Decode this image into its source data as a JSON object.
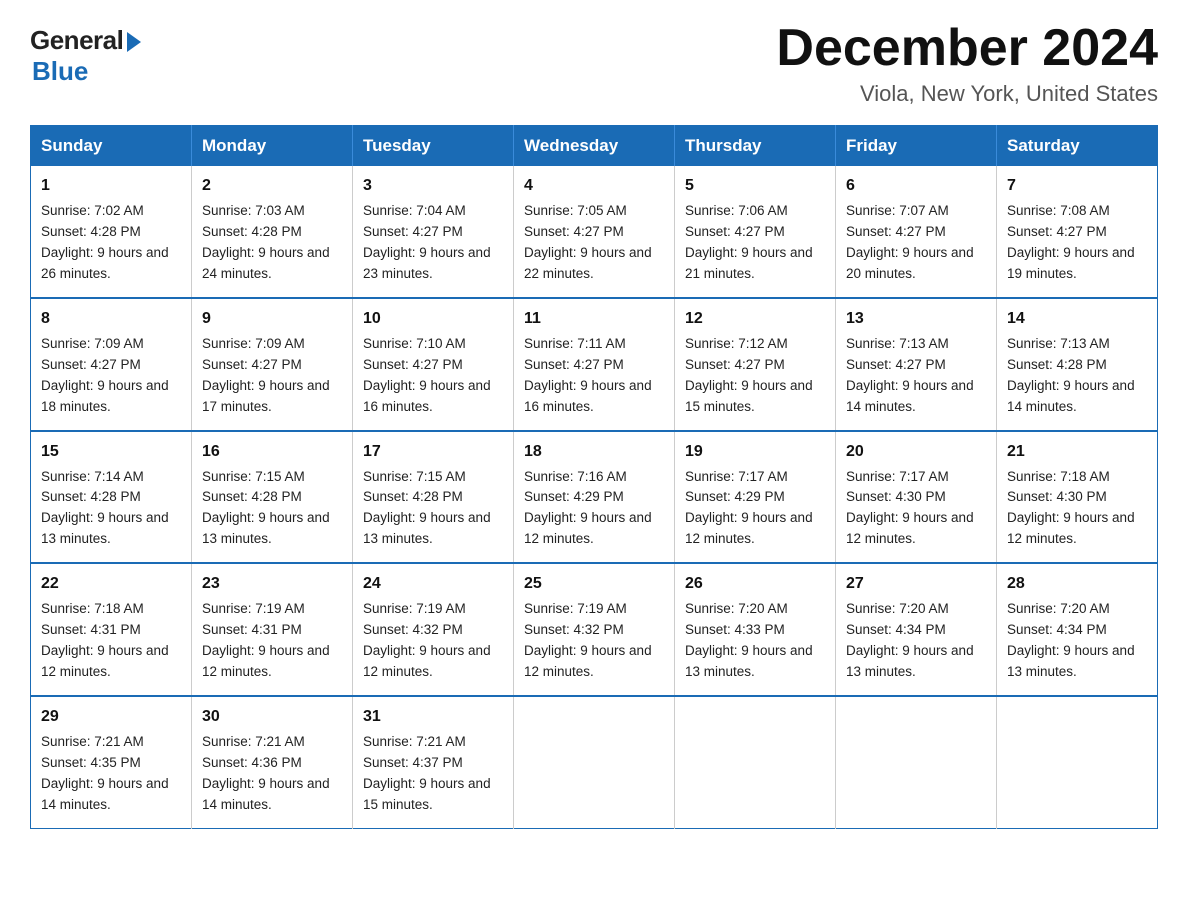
{
  "header": {
    "logo_general": "General",
    "logo_blue": "Blue",
    "month_title": "December 2024",
    "location": "Viola, New York, United States"
  },
  "days_of_week": [
    "Sunday",
    "Monday",
    "Tuesday",
    "Wednesday",
    "Thursday",
    "Friday",
    "Saturday"
  ],
  "weeks": [
    [
      {
        "day": "1",
        "sunrise": "7:02 AM",
        "sunset": "4:28 PM",
        "daylight": "9 hours and 26 minutes."
      },
      {
        "day": "2",
        "sunrise": "7:03 AM",
        "sunset": "4:28 PM",
        "daylight": "9 hours and 24 minutes."
      },
      {
        "day": "3",
        "sunrise": "7:04 AM",
        "sunset": "4:27 PM",
        "daylight": "9 hours and 23 minutes."
      },
      {
        "day": "4",
        "sunrise": "7:05 AM",
        "sunset": "4:27 PM",
        "daylight": "9 hours and 22 minutes."
      },
      {
        "day": "5",
        "sunrise": "7:06 AM",
        "sunset": "4:27 PM",
        "daylight": "9 hours and 21 minutes."
      },
      {
        "day": "6",
        "sunrise": "7:07 AM",
        "sunset": "4:27 PM",
        "daylight": "9 hours and 20 minutes."
      },
      {
        "day": "7",
        "sunrise": "7:08 AM",
        "sunset": "4:27 PM",
        "daylight": "9 hours and 19 minutes."
      }
    ],
    [
      {
        "day": "8",
        "sunrise": "7:09 AM",
        "sunset": "4:27 PM",
        "daylight": "9 hours and 18 minutes."
      },
      {
        "day": "9",
        "sunrise": "7:09 AM",
        "sunset": "4:27 PM",
        "daylight": "9 hours and 17 minutes."
      },
      {
        "day": "10",
        "sunrise": "7:10 AM",
        "sunset": "4:27 PM",
        "daylight": "9 hours and 16 minutes."
      },
      {
        "day": "11",
        "sunrise": "7:11 AM",
        "sunset": "4:27 PM",
        "daylight": "9 hours and 16 minutes."
      },
      {
        "day": "12",
        "sunrise": "7:12 AM",
        "sunset": "4:27 PM",
        "daylight": "9 hours and 15 minutes."
      },
      {
        "day": "13",
        "sunrise": "7:13 AM",
        "sunset": "4:27 PM",
        "daylight": "9 hours and 14 minutes."
      },
      {
        "day": "14",
        "sunrise": "7:13 AM",
        "sunset": "4:28 PM",
        "daylight": "9 hours and 14 minutes."
      }
    ],
    [
      {
        "day": "15",
        "sunrise": "7:14 AM",
        "sunset": "4:28 PM",
        "daylight": "9 hours and 13 minutes."
      },
      {
        "day": "16",
        "sunrise": "7:15 AM",
        "sunset": "4:28 PM",
        "daylight": "9 hours and 13 minutes."
      },
      {
        "day": "17",
        "sunrise": "7:15 AM",
        "sunset": "4:28 PM",
        "daylight": "9 hours and 13 minutes."
      },
      {
        "day": "18",
        "sunrise": "7:16 AM",
        "sunset": "4:29 PM",
        "daylight": "9 hours and 12 minutes."
      },
      {
        "day": "19",
        "sunrise": "7:17 AM",
        "sunset": "4:29 PM",
        "daylight": "9 hours and 12 minutes."
      },
      {
        "day": "20",
        "sunrise": "7:17 AM",
        "sunset": "4:30 PM",
        "daylight": "9 hours and 12 minutes."
      },
      {
        "day": "21",
        "sunrise": "7:18 AM",
        "sunset": "4:30 PM",
        "daylight": "9 hours and 12 minutes."
      }
    ],
    [
      {
        "day": "22",
        "sunrise": "7:18 AM",
        "sunset": "4:31 PM",
        "daylight": "9 hours and 12 minutes."
      },
      {
        "day": "23",
        "sunrise": "7:19 AM",
        "sunset": "4:31 PM",
        "daylight": "9 hours and 12 minutes."
      },
      {
        "day": "24",
        "sunrise": "7:19 AM",
        "sunset": "4:32 PM",
        "daylight": "9 hours and 12 minutes."
      },
      {
        "day": "25",
        "sunrise": "7:19 AM",
        "sunset": "4:32 PM",
        "daylight": "9 hours and 12 minutes."
      },
      {
        "day": "26",
        "sunrise": "7:20 AM",
        "sunset": "4:33 PM",
        "daylight": "9 hours and 13 minutes."
      },
      {
        "day": "27",
        "sunrise": "7:20 AM",
        "sunset": "4:34 PM",
        "daylight": "9 hours and 13 minutes."
      },
      {
        "day": "28",
        "sunrise": "7:20 AM",
        "sunset": "4:34 PM",
        "daylight": "9 hours and 13 minutes."
      }
    ],
    [
      {
        "day": "29",
        "sunrise": "7:21 AM",
        "sunset": "4:35 PM",
        "daylight": "9 hours and 14 minutes."
      },
      {
        "day": "30",
        "sunrise": "7:21 AM",
        "sunset": "4:36 PM",
        "daylight": "9 hours and 14 minutes."
      },
      {
        "day": "31",
        "sunrise": "7:21 AM",
        "sunset": "4:37 PM",
        "daylight": "9 hours and 15 minutes."
      },
      null,
      null,
      null,
      null
    ]
  ]
}
